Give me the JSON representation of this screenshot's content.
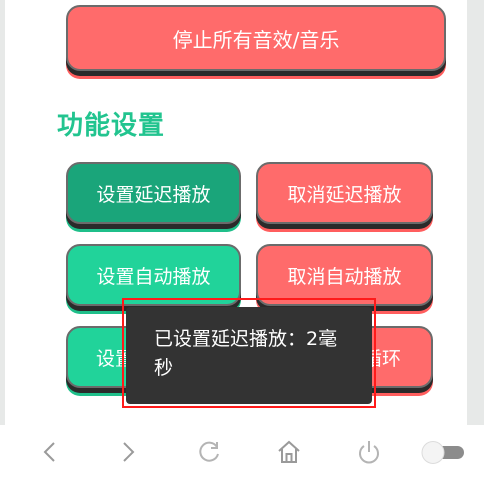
{
  "stop_all_button": "停止所有音效/音乐",
  "section_title": "功能设置",
  "buttons": {
    "set_delay": "设置延迟播放",
    "cancel_delay": "取消延迟播放",
    "set_auto": "设置自动播放",
    "cancel_auto": "取消自动播放",
    "set_loop_partial": "设置",
    "cancel_loop_partial": "循环"
  },
  "toast_message": "已设置延迟播放：2毫秒",
  "icons": {
    "back": "chevron-left-icon",
    "forward": "chevron-right-icon",
    "refresh": "refresh-icon",
    "home": "home-icon",
    "power": "power-icon",
    "toggle": "toggle-icon"
  },
  "colors": {
    "red": "#ff6b6b",
    "green": "#21d39a",
    "green_active": "#1aa57a",
    "title_green": "#22c48f",
    "toast_bg": "#333333",
    "highlight_red": "#ff1a1a"
  }
}
